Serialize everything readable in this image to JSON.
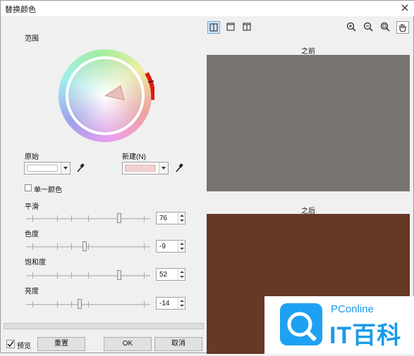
{
  "window": {
    "title": "替换颜色"
  },
  "left": {
    "range_label": "范围",
    "original_label": "原始",
    "new_label": "新建(N)",
    "single_color_label": "单一颜色",
    "original_swatch_color": "#ffffff",
    "new_swatch_color": "#f2cfd2"
  },
  "sliders": [
    {
      "label": "平滑",
      "value": "76",
      "thumb_fraction": 0.76
    },
    {
      "label": "色度",
      "value": "-9",
      "thumb_fraction": 0.47
    },
    {
      "label": "饱和度",
      "value": "52",
      "thumb_fraction": 0.76
    },
    {
      "label": "亮度",
      "value": "-14",
      "thumb_fraction": 0.43
    }
  ],
  "buttons": {
    "preview": "预览",
    "reset": "重置",
    "ok": "OK",
    "cancel": "取消"
  },
  "preview": {
    "before_label": "之前",
    "after_label": "之后",
    "before_color": "#7a7470",
    "after_color": "#663826"
  },
  "icons": {
    "view_modes": [
      "split-vertical-icon",
      "single-view-icon",
      "split-half-icon"
    ],
    "zoom_tools": [
      "zoom-in-icon",
      "zoom-out-icon",
      "zoom-fit-icon",
      "hand-pan-icon"
    ]
  },
  "watermark": {
    "brand": "PConline",
    "name": "IT百科"
  }
}
